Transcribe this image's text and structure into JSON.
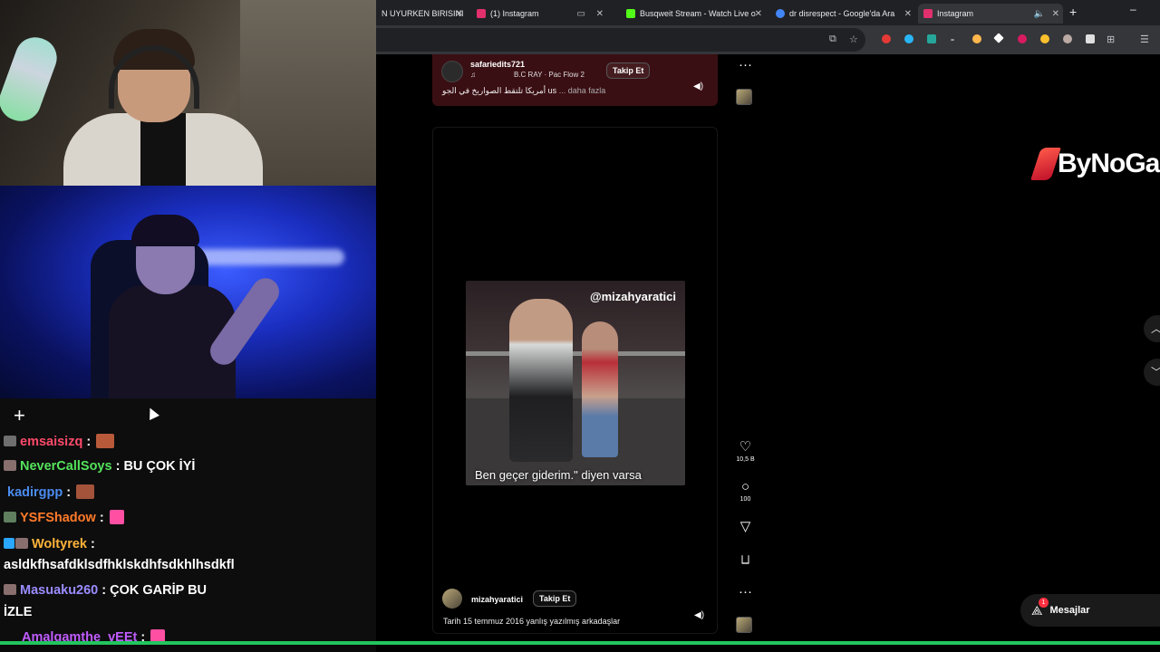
{
  "browser": {
    "tabs": [
      {
        "title": "N UYURKEN BIRISINI",
        "fav_color": "#555555",
        "active": false
      },
      {
        "title": "(1) Instagram",
        "fav_color": "#e1306c",
        "active": false
      },
      {
        "title": "Busqweit Stream - Watch Live o",
        "fav_color": "#53fc18",
        "active": false
      },
      {
        "title": "dr disrespect - Google'da Ara",
        "fav_color": "#4285f4",
        "active": false
      },
      {
        "title": "Instagram",
        "fav_color": "#e1306c",
        "active": true
      }
    ],
    "new_tab": "+",
    "minimize": "–"
  },
  "chat": {
    "messages": [
      {
        "user": "emsaisizq",
        "color": "#ff4a6b",
        "text": "",
        "emote": "#b85a3a"
      },
      {
        "user": "NeverCallSoys",
        "color": "#54e35c",
        "text": "BU ÇOK İYİ"
      },
      {
        "user": "kadirgpp",
        "color": "#4a8cf0",
        "text": "",
        "emote": "#a3533a"
      },
      {
        "user": "YSFShadow",
        "color": "#ff7a2a",
        "text": "",
        "emote": "#ff4fa3"
      },
      {
        "user": "Woltyrek",
        "color": "#ffb43a",
        "text": ""
      },
      {
        "user": "",
        "color": "#ffffff",
        "text": "asldkfhsafdklsdfhklskdhfsdkhlhsdkfl"
      },
      {
        "user": "Masuaku260",
        "color": "#9a8cff",
        "text": "ÇOK GARİP BU"
      },
      {
        "user": "",
        "color": "#ffffff",
        "text": "İZLE"
      },
      {
        "user": "Amalgamthe_vEEt",
        "color": "#c05cff",
        "text": "",
        "emote": "#ff4fa3"
      }
    ]
  },
  "post1": {
    "username": "safariedits721",
    "music_icon": "♫",
    "song": "B.C RAY · Pac Flow 2",
    "follow": "Takip Et",
    "caption": "أمريكا تلتقط الصواريخ في الجو us",
    "more": "... daha fazla"
  },
  "post2": {
    "video_handle": "@mizahyaratici",
    "subtitle": "Ben geçer giderim.\" diyen varsa",
    "username": "mizahyaratici",
    "follow": "Takip Et",
    "caption": "Tarih 15 temmuz 2016 yanlış yazılmış arkadaşlar"
  },
  "actions": {
    "like_icon": "♡",
    "likes": "10,5 B",
    "comment_icon": "○",
    "comments": "100",
    "share_icon": "▽",
    "save_icon": "⊏",
    "more": "···"
  },
  "overlay": {
    "logo_text": "ByNoGa",
    "messages_label": "Mesajlar",
    "messages_badge": "1"
  }
}
